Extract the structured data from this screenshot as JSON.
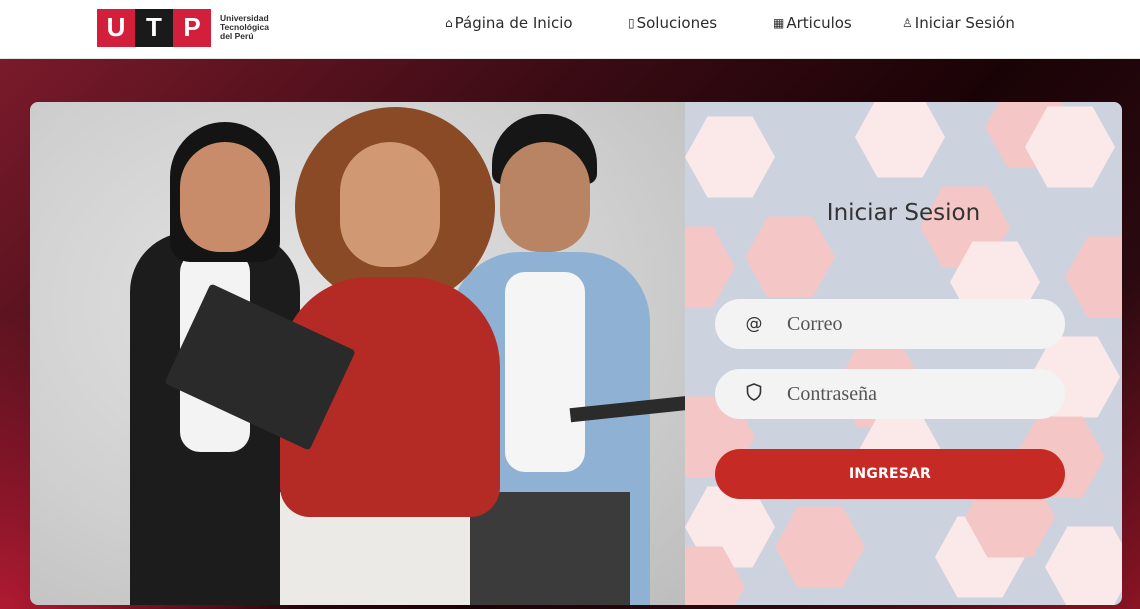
{
  "logo": {
    "letters": [
      "U",
      "T",
      "P"
    ],
    "institution_name": "Universidad Tecnológica del Perú",
    "colors": {
      "red": "#d21f3c",
      "black": "#1a1a1a"
    }
  },
  "nav": {
    "items": [
      {
        "icon": "home-icon",
        "label": "Página de Inicio"
      },
      {
        "icon": "book-icon",
        "label": "Soluciones"
      },
      {
        "icon": "calendar-icon",
        "label": "Articulos"
      },
      {
        "icon": "user-icon",
        "label": "Iniciar Sesión"
      }
    ]
  },
  "login": {
    "title": "Iniciar Sesion",
    "email": {
      "icon": "at-icon",
      "placeholder": "Correo",
      "value": ""
    },
    "password": {
      "icon": "shield-icon",
      "placeholder": "Contraseña",
      "value": ""
    },
    "submit_label": "INGRESAR",
    "accent_color": "#c62a25"
  },
  "hero_image": {
    "description": "three students standing"
  }
}
